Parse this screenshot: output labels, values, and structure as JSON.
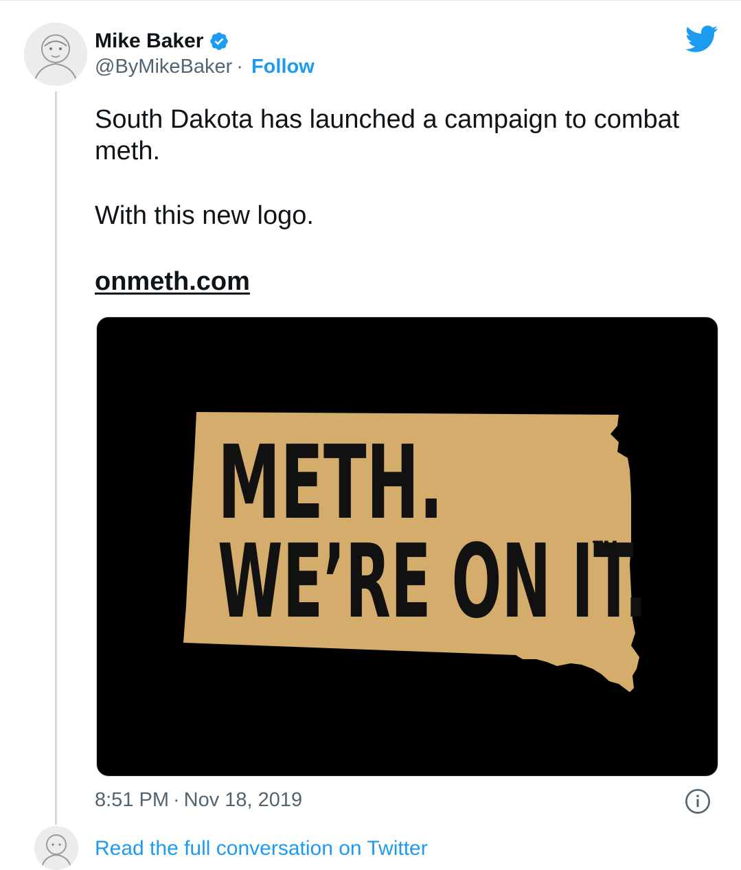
{
  "author": {
    "name": "Mike Baker",
    "handle": "@ByMikeBaker",
    "separator": "·",
    "follow_label": "Follow",
    "verified_icon": "verified-badge-icon"
  },
  "tweet": {
    "line1": "South Dakota has launched a campaign to combat meth.",
    "line2": "With this new logo.",
    "link_text": "onmeth.com"
  },
  "media": {
    "logo_line1": "METH.",
    "logo_line2": "WE’RE ON IT.",
    "trademark": "TM",
    "state_color": "#d4ac6c",
    "background_color": "#000000"
  },
  "meta": {
    "time": "8:51 PM",
    "separator": "·",
    "date": "Nov 18, 2019"
  },
  "footer": {
    "read_full_label": "Read the full conversation on Twitter"
  },
  "colors": {
    "accent": "#1d9bf0",
    "text": "#0f1419",
    "secondary": "#536471"
  }
}
